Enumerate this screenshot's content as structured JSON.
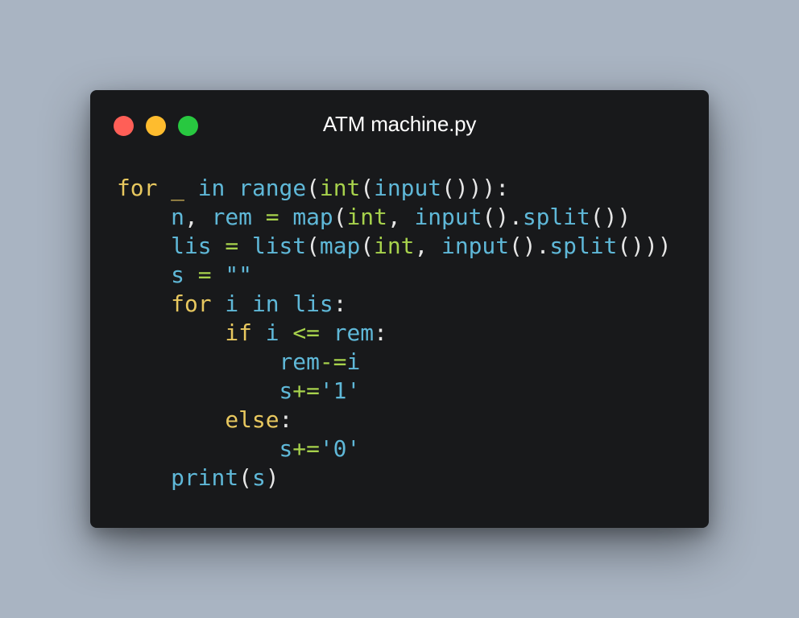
{
  "window": {
    "title": "ATM machine.py",
    "controls": [
      "close-icon",
      "minimize-icon",
      "maximize-icon"
    ],
    "colors": {
      "close": "#ff5f57",
      "minimize": "#febc2e",
      "maximize": "#28c840",
      "background": "#18191b",
      "page_background": "#a9b4c2"
    }
  },
  "syntax_colors": {
    "keyword": "#e8c85f",
    "identifier": "#5fb8d8",
    "builtin": "#a7d24c",
    "punctuation": "#e6e6e6"
  },
  "code": {
    "lines": [
      [
        {
          "t": "for",
          "c": "kw"
        },
        {
          "t": " ",
          "c": "pn"
        },
        {
          "t": "_",
          "c": "kw"
        },
        {
          "t": " ",
          "c": "pn"
        },
        {
          "t": "in",
          "c": "id"
        },
        {
          "t": " ",
          "c": "pn"
        },
        {
          "t": "range",
          "c": "id"
        },
        {
          "t": "(",
          "c": "pn"
        },
        {
          "t": "int",
          "c": "fn"
        },
        {
          "t": "(",
          "c": "pn"
        },
        {
          "t": "input",
          "c": "id"
        },
        {
          "t": "())):",
          "c": "pn"
        }
      ],
      [
        {
          "t": "    ",
          "c": "pn"
        },
        {
          "t": "n",
          "c": "id"
        },
        {
          "t": ", ",
          "c": "pn"
        },
        {
          "t": "rem",
          "c": "id"
        },
        {
          "t": " ",
          "c": "pn"
        },
        {
          "t": "=",
          "c": "fn"
        },
        {
          "t": " ",
          "c": "pn"
        },
        {
          "t": "map",
          "c": "id"
        },
        {
          "t": "(",
          "c": "pn"
        },
        {
          "t": "int",
          "c": "fn"
        },
        {
          "t": ", ",
          "c": "pn"
        },
        {
          "t": "input",
          "c": "id"
        },
        {
          "t": "().",
          "c": "pn"
        },
        {
          "t": "split",
          "c": "id"
        },
        {
          "t": "())",
          "c": "pn"
        }
      ],
      [
        {
          "t": "    ",
          "c": "pn"
        },
        {
          "t": "lis",
          "c": "id"
        },
        {
          "t": " ",
          "c": "pn"
        },
        {
          "t": "=",
          "c": "fn"
        },
        {
          "t": " ",
          "c": "pn"
        },
        {
          "t": "list",
          "c": "id"
        },
        {
          "t": "(",
          "c": "pn"
        },
        {
          "t": "map",
          "c": "id"
        },
        {
          "t": "(",
          "c": "pn"
        },
        {
          "t": "int",
          "c": "fn"
        },
        {
          "t": ", ",
          "c": "pn"
        },
        {
          "t": "input",
          "c": "id"
        },
        {
          "t": "().",
          "c": "pn"
        },
        {
          "t": "split",
          "c": "id"
        },
        {
          "t": "()))",
          "c": "pn"
        }
      ],
      [
        {
          "t": "    ",
          "c": "pn"
        },
        {
          "t": "s",
          "c": "id"
        },
        {
          "t": " ",
          "c": "pn"
        },
        {
          "t": "=",
          "c": "fn"
        },
        {
          "t": " ",
          "c": "pn"
        },
        {
          "t": "\"\"",
          "c": "st"
        }
      ],
      [
        {
          "t": "    ",
          "c": "pn"
        },
        {
          "t": "for",
          "c": "kw"
        },
        {
          "t": " ",
          "c": "pn"
        },
        {
          "t": "i",
          "c": "id"
        },
        {
          "t": " ",
          "c": "pn"
        },
        {
          "t": "in",
          "c": "id"
        },
        {
          "t": " ",
          "c": "pn"
        },
        {
          "t": "lis",
          "c": "id"
        },
        {
          "t": ":",
          "c": "pn"
        }
      ],
      [
        {
          "t": "        ",
          "c": "pn"
        },
        {
          "t": "if",
          "c": "kw"
        },
        {
          "t": " ",
          "c": "pn"
        },
        {
          "t": "i",
          "c": "id"
        },
        {
          "t": " ",
          "c": "pn"
        },
        {
          "t": "<=",
          "c": "fn"
        },
        {
          "t": " ",
          "c": "pn"
        },
        {
          "t": "rem",
          "c": "id"
        },
        {
          "t": ":",
          "c": "pn"
        }
      ],
      [
        {
          "t": "            ",
          "c": "pn"
        },
        {
          "t": "rem",
          "c": "id"
        },
        {
          "t": "-=",
          "c": "fn"
        },
        {
          "t": "i",
          "c": "id"
        }
      ],
      [
        {
          "t": "            ",
          "c": "pn"
        },
        {
          "t": "s",
          "c": "id"
        },
        {
          "t": "+=",
          "c": "fn"
        },
        {
          "t": "'1'",
          "c": "st"
        }
      ],
      [
        {
          "t": "        ",
          "c": "pn"
        },
        {
          "t": "else",
          "c": "kw"
        },
        {
          "t": ":",
          "c": "pn"
        }
      ],
      [
        {
          "t": "            ",
          "c": "pn"
        },
        {
          "t": "s",
          "c": "id"
        },
        {
          "t": "+=",
          "c": "fn"
        },
        {
          "t": "'0'",
          "c": "st"
        }
      ],
      [
        {
          "t": "    ",
          "c": "pn"
        },
        {
          "t": "print",
          "c": "id"
        },
        {
          "t": "(",
          "c": "pn"
        },
        {
          "t": "s",
          "c": "id"
        },
        {
          "t": ")",
          "c": "pn"
        }
      ]
    ]
  }
}
